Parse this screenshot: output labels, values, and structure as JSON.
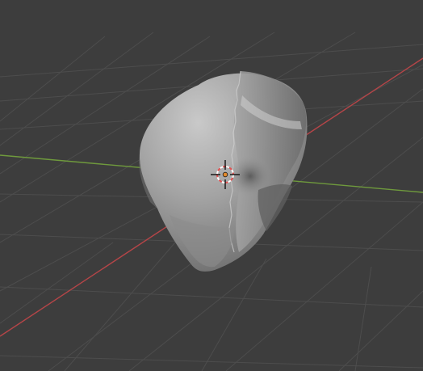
{
  "viewport": {
    "background": "#3d3d3d",
    "grid_color": "#505050",
    "x_axis_color": "#b54548",
    "y_axis_color": "#6f9a3d"
  },
  "object": {
    "kind": "sculpted-mesh",
    "fill": "#8f8f8f",
    "shade_light": "#b8b8b8",
    "shade_dark": "#5a5a5a"
  },
  "origin": {
    "icon": "origin-point-icon",
    "color": "#e28a2c"
  },
  "cursor_3d": {
    "icon": "3d-cursor-icon",
    "ring_color_a": "#e25050",
    "ring_color_b": "#ffffff"
  }
}
